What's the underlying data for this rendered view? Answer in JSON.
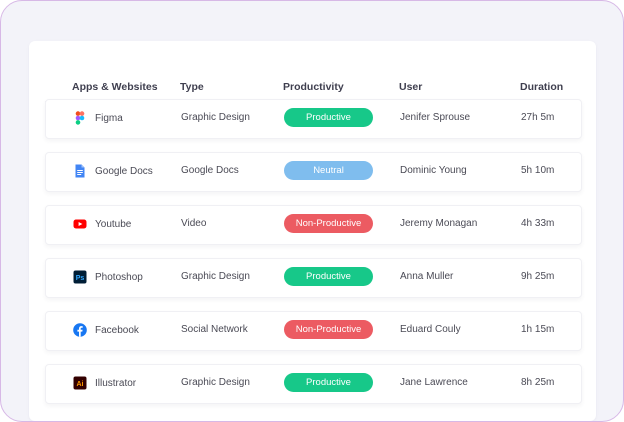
{
  "table": {
    "headers": {
      "app": "Apps & Websites",
      "type": "Type",
      "productivity": "Productivity",
      "user": "User",
      "duration": "Duration"
    },
    "rows": [
      {
        "app": "Figma",
        "icon": "figma-icon",
        "type": "Graphic Design",
        "productivity": "Productive",
        "status_color": "#17c889",
        "user": "Jenifer Sprouse",
        "duration": "27h 5m"
      },
      {
        "app": "Google Docs",
        "icon": "google-docs-icon",
        "type": "Google Docs",
        "productivity": "Neutral",
        "status_color": "#7fbdee",
        "user": "Dominic Young",
        "duration": "5h 10m"
      },
      {
        "app": "Youtube",
        "icon": "youtube-icon",
        "type": "Video",
        "productivity": "Non-Productive",
        "status_color": "#ec5b62",
        "user": "Jeremy Monagan",
        "duration": "4h 33m"
      },
      {
        "app": "Photoshop",
        "icon": "photoshop-icon",
        "type": "Graphic Design",
        "productivity": "Productive",
        "status_color": "#17c889",
        "user": "Anna Muller",
        "duration": "9h 25m"
      },
      {
        "app": "Facebook",
        "icon": "facebook-icon",
        "type": "Social Network",
        "productivity": "Non-Productive",
        "status_color": "#ec5b62",
        "user": "Eduard Couly",
        "duration": "1h 15m"
      },
      {
        "app": "Illustrator",
        "icon": "illustrator-icon",
        "type": "Graphic Design",
        "productivity": "Productive",
        "status_color": "#17c889",
        "user": "Jane Lawrence",
        "duration": "8h 25m"
      }
    ]
  },
  "colors": {
    "productive": "#17c889",
    "neutral": "#7fbdee",
    "non_productive": "#ec5b62",
    "frame_border": "#d7b8e6"
  }
}
